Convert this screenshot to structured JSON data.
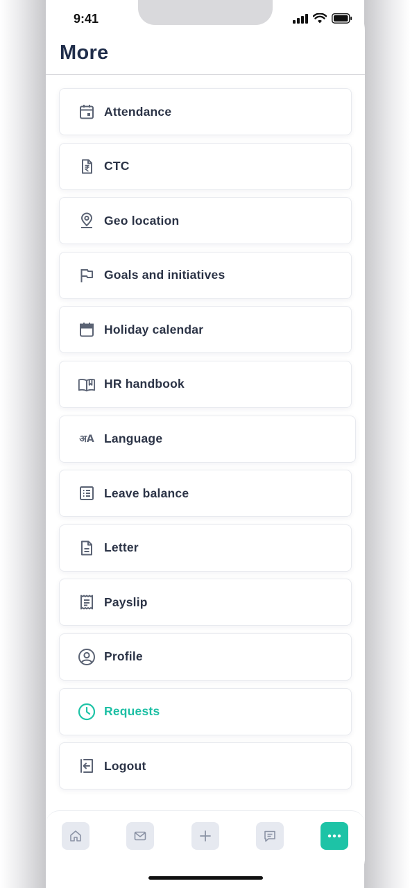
{
  "status_bar": {
    "time": "9:41"
  },
  "page": {
    "title": "More"
  },
  "menu": {
    "items": [
      {
        "label": "Attendance",
        "icon": "calendar-day-icon"
      },
      {
        "label": "CTC",
        "icon": "rupee-document-icon"
      },
      {
        "label": "Geo location",
        "icon": "map-pin-icon"
      },
      {
        "label": "Goals and initiatives",
        "icon": "flag-icon"
      },
      {
        "label": "Holiday calendar",
        "icon": "calendar-icon"
      },
      {
        "label": "HR handbook",
        "icon": "book-open-icon"
      },
      {
        "label": "Language",
        "icon": "language-icon",
        "glyph": "अA"
      },
      {
        "label": "Leave balance",
        "icon": "list-icon"
      },
      {
        "label": "Letter",
        "icon": "document-icon"
      },
      {
        "label": "Payslip",
        "icon": "receipt-icon"
      },
      {
        "label": "Profile",
        "icon": "user-circle-icon"
      },
      {
        "label": "Requests",
        "icon": "clock-icon",
        "active": true
      },
      {
        "label": "Logout",
        "icon": "logout-icon"
      }
    ]
  },
  "bottom_nav": {
    "tabs": [
      {
        "name": "home",
        "icon": "home-icon"
      },
      {
        "name": "mail",
        "icon": "mail-icon"
      },
      {
        "name": "add",
        "icon": "plus-icon"
      },
      {
        "name": "messages",
        "icon": "chat-icon"
      },
      {
        "name": "more",
        "icon": "more-dots-icon",
        "active": true
      }
    ]
  },
  "colors": {
    "accent": "#1dc3a6",
    "title": "#1f2d4a",
    "text": "#2b3346",
    "icon": "#5b6374"
  }
}
